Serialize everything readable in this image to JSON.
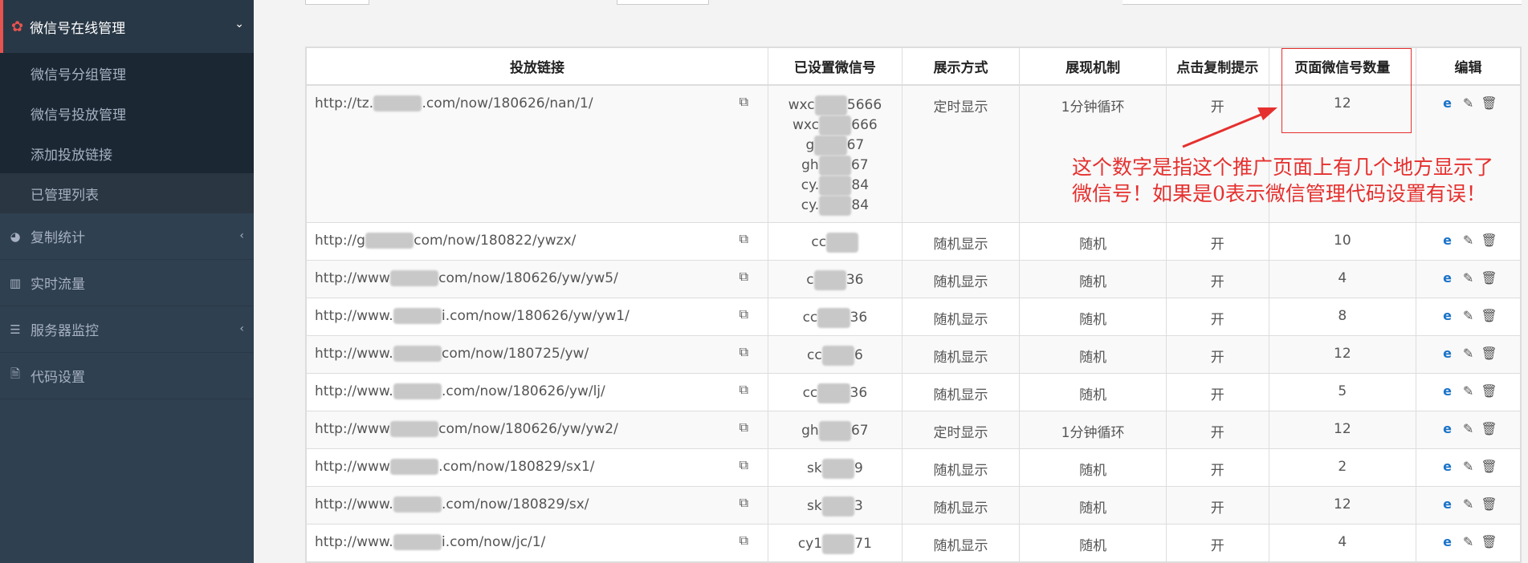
{
  "sidebar": {
    "parent": {
      "label": "微信号在线管理",
      "icon": "wechat-icon",
      "chevron": "⌄"
    },
    "sub_items": [
      "微信号分组管理",
      "微信号投放管理",
      "添加投放链接",
      "已管理列表"
    ],
    "nav": [
      {
        "label": "复制统计",
        "icon": "pie-chart-icon",
        "glyph": "◕",
        "chevron": "‹"
      },
      {
        "label": "实时流量",
        "icon": "bar-chart-icon",
        "glyph": "▥",
        "chevron": ""
      },
      {
        "label": "服务器监控",
        "icon": "server-icon",
        "glyph": "☰",
        "chevron": "‹"
      },
      {
        "label": "代码设置",
        "icon": "file-code-icon",
        "glyph": "🗎",
        "chevron": ""
      }
    ]
  },
  "table": {
    "headers": [
      "投放链接",
      "已设置微信号",
      "展示方式",
      "展现机制",
      "点击复制提示",
      "页面微信号数量",
      "编辑"
    ],
    "rows": [
      {
        "link_pre": "http://tz.",
        "link_post": ".com/now/180626/nan/1/",
        "wx": [
          "wxc█5666",
          "wxc█666",
          "g█67",
          "gh█67",
          "cy.█84",
          "cy.█84"
        ],
        "mode": "定时显示",
        "mech": "1分钟循环",
        "tip": "开",
        "count": "12"
      },
      {
        "link_pre": "http://g",
        "link_post": "com/now/180822/ywzx/",
        "wx": [
          "cc█"
        ],
        "mode": "随机显示",
        "mech": "随机",
        "tip": "开",
        "count": "10"
      },
      {
        "link_pre": "http://www",
        "link_post": "com/now/180626/yw/yw5/",
        "wx": [
          "c█36"
        ],
        "mode": "随机显示",
        "mech": "随机",
        "tip": "开",
        "count": "4"
      },
      {
        "link_pre": "http://www.",
        "link_post": "i.com/now/180626/yw/yw1/",
        "wx": [
          "cc█36"
        ],
        "mode": "随机显示",
        "mech": "随机",
        "tip": "开",
        "count": "8"
      },
      {
        "link_pre": "http://www.",
        "link_post": "com/now/180725/yw/",
        "wx": [
          "cc█6"
        ],
        "mode": "随机显示",
        "mech": "随机",
        "tip": "开",
        "count": "12"
      },
      {
        "link_pre": "http://www.",
        "link_post": ".com/now/180626/yw/lj/",
        "wx": [
          "cc█36"
        ],
        "mode": "随机显示",
        "mech": "随机",
        "tip": "开",
        "count": "5"
      },
      {
        "link_pre": "http://www",
        "link_post": "com/now/180626/yw/yw2/",
        "wx": [
          "gh█67"
        ],
        "mode": "定时显示",
        "mech": "1分钟循环",
        "tip": "开",
        "count": "12"
      },
      {
        "link_pre": "http://www",
        "link_post": ".com/now/180829/sx1/",
        "wx": [
          "sk█9"
        ],
        "mode": "随机显示",
        "mech": "随机",
        "tip": "开",
        "count": "2"
      },
      {
        "link_pre": "http://www.",
        "link_post": ".com/now/180829/sx/",
        "wx": [
          "sk█3"
        ],
        "mode": "随机显示",
        "mech": "随机",
        "tip": "开",
        "count": "12"
      },
      {
        "link_pre": "http://www.",
        "link_post": "i.com/now/jc/1/",
        "wx": [
          "cy1█71"
        ],
        "mode": "随机显示",
        "mech": "随机",
        "tip": "开",
        "count": "4"
      }
    ]
  },
  "annotation": {
    "line1": "这个数字是指这个推广页面上有几个地方显示了",
    "line2": "微信号！如果是0表示微信管理代码设置有误！",
    "color": "#e5302e"
  },
  "icons": {
    "copy": "copy-icon",
    "ie": "ie-icon",
    "edit": "edit-icon",
    "trash": "trash-icon"
  }
}
